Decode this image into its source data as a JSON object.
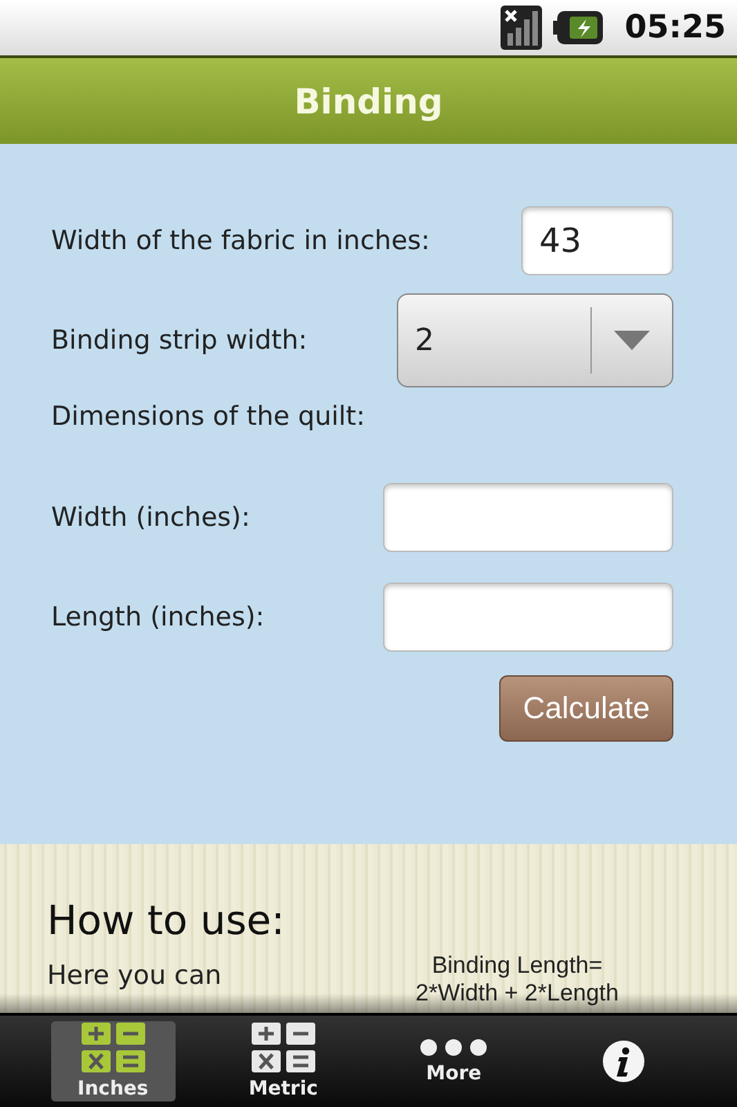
{
  "status_bar": {
    "time": "05:25"
  },
  "title": "Binding",
  "form": {
    "fabric_width": {
      "label": "Width of the fabric in inches:",
      "value": "43"
    },
    "strip_width": {
      "label": "Binding strip width:",
      "value": "2"
    },
    "dimensions_label": "Dimensions of the quilt:",
    "fields": [
      {
        "label": "Width (inches):"
      },
      {
        "label": "Length (inches):"
      }
    ],
    "button": "Calculate"
  },
  "help": {
    "heading": "How to use:",
    "text": "Here you can",
    "formula": [
      "Binding Length=",
      "2*Width + 2*Length"
    ]
  },
  "tabs": [
    {
      "label": "Inches",
      "kind": "calc",
      "selected": true
    },
    {
      "label": "Metric",
      "kind": "calc",
      "selected": false
    },
    {
      "label": "More",
      "kind": "more",
      "selected": false
    },
    {
      "kind": "info",
      "selected": false
    }
  ]
}
